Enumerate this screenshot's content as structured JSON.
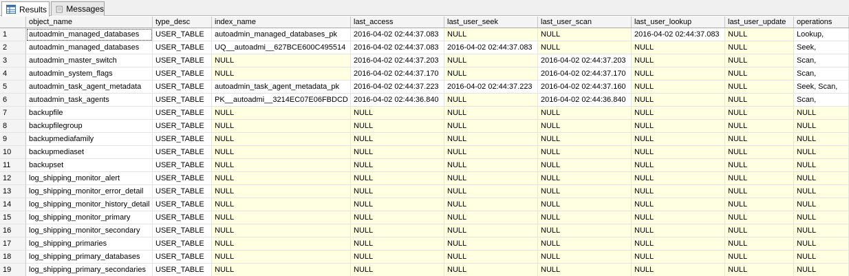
{
  "tabs": [
    {
      "label": "Results",
      "icon": "grid-icon",
      "active": true
    },
    {
      "label": "Messages",
      "icon": "document-icon",
      "active": false
    }
  ],
  "columns": [
    "",
    "object_name",
    "type_desc",
    "index_name",
    "last_access",
    "last_user_seek",
    "last_user_scan",
    "last_user_lookup",
    "last_user_update",
    "operations"
  ],
  "rows": [
    [
      "1",
      "autoadmin_managed_databases",
      "USER_TABLE",
      "autoadmin_managed_databases_pk",
      "2016-04-02 02:44:37.083",
      "NULL",
      "NULL",
      "2016-04-02 02:44:37.083",
      "NULL",
      "Lookup,"
    ],
    [
      "2",
      "autoadmin_managed_databases",
      "USER_TABLE",
      "UQ__autoadmi__627BCE600C495514",
      "2016-04-02 02:44:37.083",
      "2016-04-02 02:44:37.083",
      "NULL",
      "NULL",
      "NULL",
      "Seek,"
    ],
    [
      "3",
      "autoadmin_master_switch",
      "USER_TABLE",
      "NULL",
      "2016-04-02 02:44:37.203",
      "NULL",
      "2016-04-02 02:44:37.203",
      "NULL",
      "NULL",
      "Scan,"
    ],
    [
      "4",
      "autoadmin_system_flags",
      "USER_TABLE",
      "NULL",
      "2016-04-02 02:44:37.170",
      "NULL",
      "2016-04-02 02:44:37.170",
      "NULL",
      "NULL",
      "Scan,"
    ],
    [
      "5",
      "autoadmin_task_agent_metadata",
      "USER_TABLE",
      "autoadmin_task_agent_metadata_pk",
      "2016-04-02 02:44:37.223",
      "2016-04-02 02:44:37.223",
      "2016-04-02 02:44:37.160",
      "NULL",
      "NULL",
      "Seek, Scan,"
    ],
    [
      "6",
      "autoadmin_task_agents",
      "USER_TABLE",
      "PK__autoadmi__3214EC07E06FBDCD",
      "2016-04-02 02:44:36.840",
      "NULL",
      "2016-04-02 02:44:36.840",
      "NULL",
      "NULL",
      "Scan,"
    ],
    [
      "7",
      "backupfile",
      "USER_TABLE",
      "NULL",
      "NULL",
      "NULL",
      "NULL",
      "NULL",
      "NULL",
      "NULL"
    ],
    [
      "8",
      "backupfilegroup",
      "USER_TABLE",
      "NULL",
      "NULL",
      "NULL",
      "NULL",
      "NULL",
      "NULL",
      "NULL"
    ],
    [
      "9",
      "backupmediafamily",
      "USER_TABLE",
      "NULL",
      "NULL",
      "NULL",
      "NULL",
      "NULL",
      "NULL",
      "NULL"
    ],
    [
      "10",
      "backupmediaset",
      "USER_TABLE",
      "NULL",
      "NULL",
      "NULL",
      "NULL",
      "NULL",
      "NULL",
      "NULL"
    ],
    [
      "11",
      "backupset",
      "USER_TABLE",
      "NULL",
      "NULL",
      "NULL",
      "NULL",
      "NULL",
      "NULL",
      "NULL"
    ],
    [
      "12",
      "log_shipping_monitor_alert",
      "USER_TABLE",
      "NULL",
      "NULL",
      "NULL",
      "NULL",
      "NULL",
      "NULL",
      "NULL"
    ],
    [
      "13",
      "log_shipping_monitor_error_detail",
      "USER_TABLE",
      "NULL",
      "NULL",
      "NULL",
      "NULL",
      "NULL",
      "NULL",
      "NULL"
    ],
    [
      "14",
      "log_shipping_monitor_history_detail",
      "USER_TABLE",
      "NULL",
      "NULL",
      "NULL",
      "NULL",
      "NULL",
      "NULL",
      "NULL"
    ],
    [
      "15",
      "log_shipping_monitor_primary",
      "USER_TABLE",
      "NULL",
      "NULL",
      "NULL",
      "NULL",
      "NULL",
      "NULL",
      "NULL"
    ],
    [
      "16",
      "log_shipping_monitor_secondary",
      "USER_TABLE",
      "NULL",
      "NULL",
      "NULL",
      "NULL",
      "NULL",
      "NULL",
      "NULL"
    ],
    [
      "17",
      "log_shipping_primaries",
      "USER_TABLE",
      "NULL",
      "NULL",
      "NULL",
      "NULL",
      "NULL",
      "NULL",
      "NULL"
    ],
    [
      "18",
      "log_shipping_primary_databases",
      "USER_TABLE",
      "NULL",
      "NULL",
      "NULL",
      "NULL",
      "NULL",
      "NULL",
      "NULL"
    ],
    [
      "19",
      "log_shipping_primary_secondaries",
      "USER_TABLE",
      "NULL",
      "NULL",
      "NULL",
      "NULL",
      "NULL",
      "NULL",
      "NULL"
    ]
  ],
  "null_text": "NULL",
  "colors": {
    "null_cell": "#ffffe1",
    "header_bg": "#f4f4f4",
    "grid_line": "#e3e3e3"
  }
}
